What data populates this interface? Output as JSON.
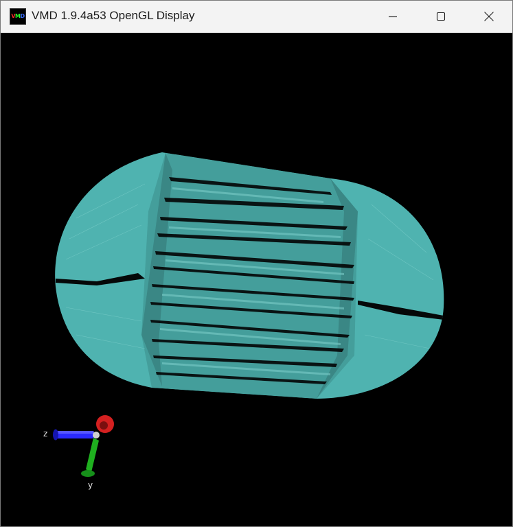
{
  "window": {
    "title": "VMD 1.9.4a53 OpenGL Display",
    "icon": "vmd-app-icon",
    "icon_letters": [
      "V",
      "M",
      "D"
    ]
  },
  "controls": {
    "minimize": "minimize-icon",
    "maximize": "maximize-icon",
    "close": "close-icon"
  },
  "scene": {
    "background_color": "#000000",
    "molecule_color": "#4fb3b0",
    "shape": "capsule-mesh"
  },
  "axes": {
    "z_label": "z",
    "y_label": "y",
    "colors": {
      "x": "#d42020",
      "y": "#1fb01f",
      "z": "#2a2aff"
    }
  }
}
